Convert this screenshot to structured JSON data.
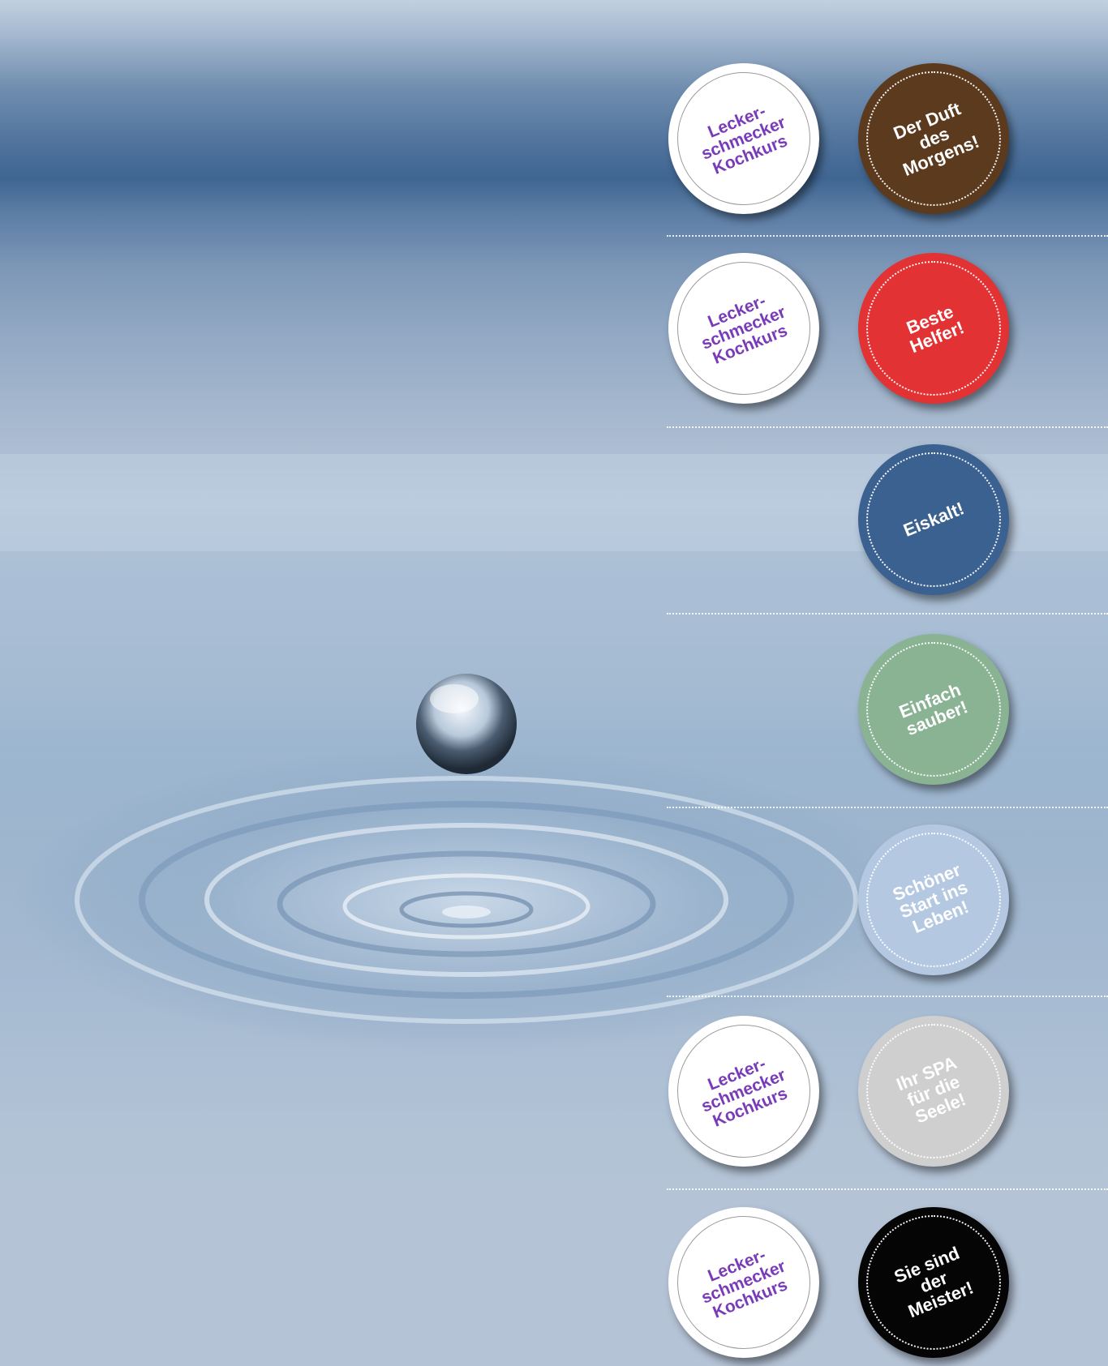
{
  "stickers": {
    "row1": {
      "left": {
        "text": "Lecker-\nschmecker\nKochkurs",
        "color": "#ffffff",
        "text_color": "#7a3bb8"
      },
      "right": {
        "text": "Der Duft\ndes\nMorgens!",
        "color": "#5c3a1e",
        "text_color": "#ffffff"
      }
    },
    "row2": {
      "left": {
        "text": "Lecker-\nschmecker\nKochkurs",
        "color": "#ffffff",
        "text_color": "#7a3bb8"
      },
      "right": {
        "text": "Beste\nHelfer!",
        "color": "#e33234",
        "text_color": "#ffffff"
      }
    },
    "row3": {
      "right": {
        "text": "Eiskalt!",
        "color": "#3b6190",
        "text_color": "#ffffff"
      }
    },
    "row4": {
      "right": {
        "text": "Einfach\nsauber!",
        "color": "#8ab394",
        "text_color": "#ffffff"
      }
    },
    "row5": {
      "right": {
        "text": "Schöner\nStart ins\nLeben!",
        "color": "#b5c8e2",
        "text_color": "#ffffff"
      }
    },
    "row6": {
      "left": {
        "text": "Lecker-\nschmecker\nKochkurs",
        "color": "#ffffff",
        "text_color": "#7a3bb8"
      },
      "right": {
        "text": "Ihr SPA\nfür die\nSeele!",
        "color": "#cfcfcf",
        "text_color": "#ffffff"
      }
    },
    "row7": {
      "left": {
        "text": "Lecker-\nschmecker\nKochkurs",
        "color": "#ffffff",
        "text_color": "#7a3bb8"
      },
      "right": {
        "text": "Sie sind\nder\nMeister!",
        "color": "#050505",
        "text_color": "#ffffff"
      }
    }
  }
}
